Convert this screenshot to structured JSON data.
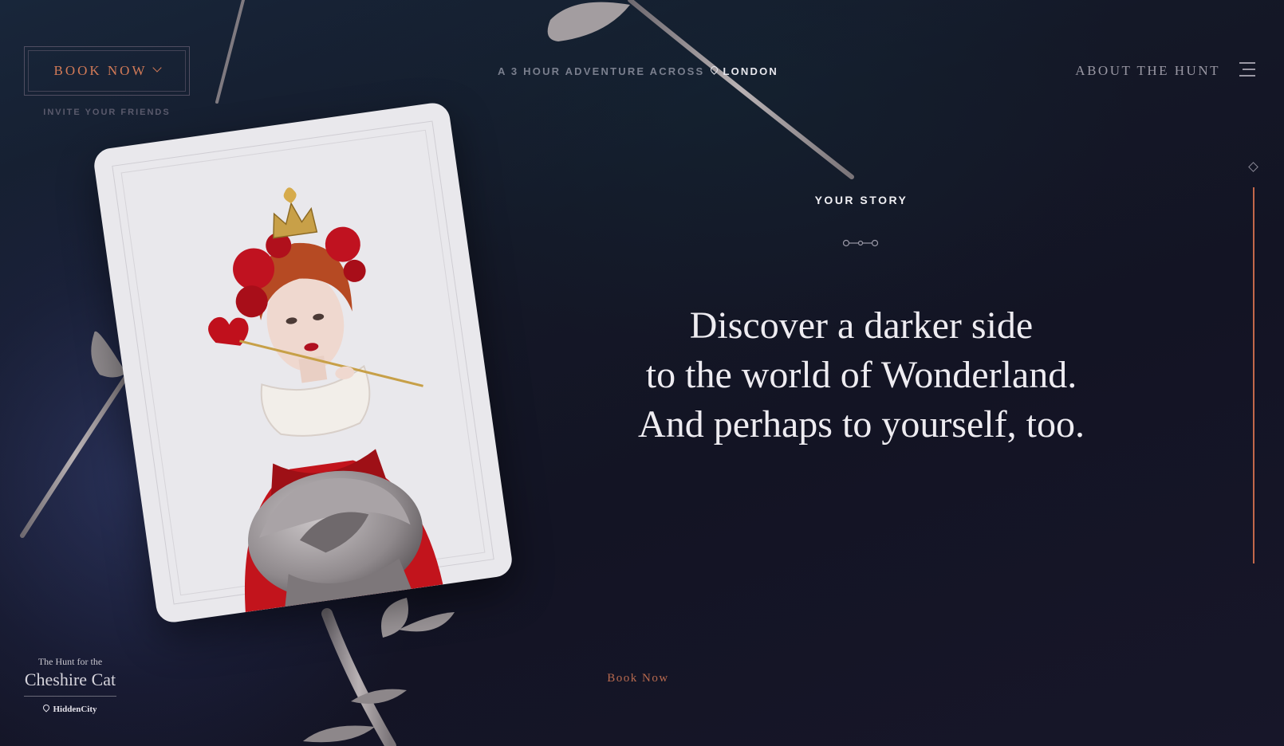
{
  "header": {
    "book_now": "BOOK NOW",
    "invite": "INVITE YOUR FRIENDS",
    "tagline_prefix": "A 3 HOUR ADVENTURE ACROSS",
    "tagline_city": "LONDON",
    "about": "ABOUT THE HUNT"
  },
  "story": {
    "label": "YOUR STORY",
    "line1": "Discover a darker side",
    "line2": "to the world of Wonderland.",
    "line3": "And perhaps to yourself, too."
  },
  "footer": {
    "book_now": "Book Now",
    "logo_small": "The Hunt for the",
    "logo_big": "Cheshire Cat",
    "brand": "HiddenCity"
  },
  "colors": {
    "accent": "#d27a57",
    "background": "#141827",
    "progress": "#c2674a"
  },
  "icons": {
    "menu": "hamburger-icon",
    "dropdown": "chevron-down-icon",
    "location": "map-pin-icon",
    "divider": "ornament-icon"
  }
}
